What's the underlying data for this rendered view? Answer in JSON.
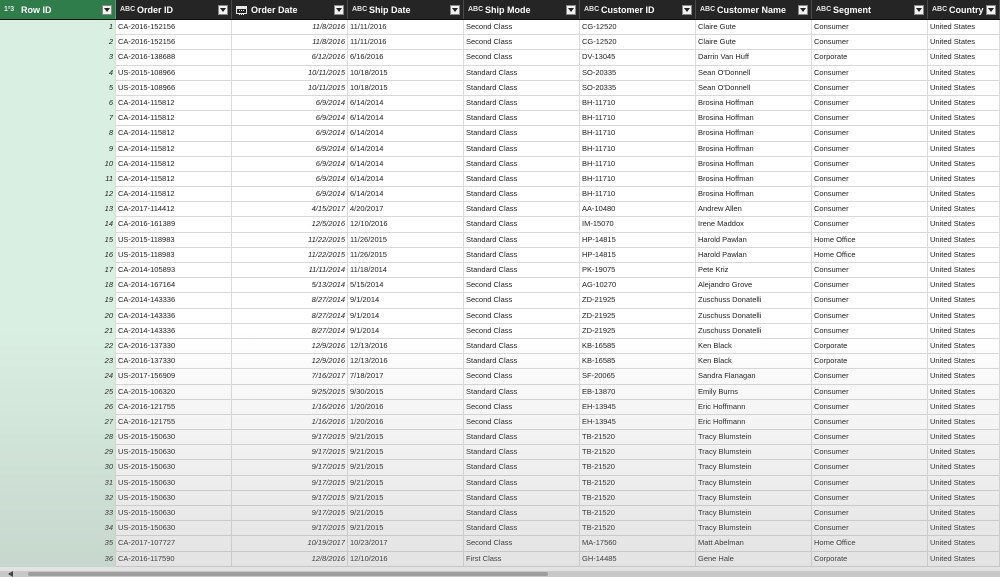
{
  "columns": [
    {
      "label": "Row ID",
      "type": "1²3"
    },
    {
      "label": "Order ID",
      "type": "ABC"
    },
    {
      "label": "Order Date",
      "type": "date"
    },
    {
      "label": "Ship Date",
      "type": "ABC"
    },
    {
      "label": "Ship Mode",
      "type": "ABC"
    },
    {
      "label": "Customer ID",
      "type": "ABC"
    },
    {
      "label": "Customer Name",
      "type": "ABC"
    },
    {
      "label": "Segment",
      "type": "ABC"
    },
    {
      "label": "Country",
      "type": "ABC"
    }
  ],
  "rows": [
    [
      "1",
      "CA-2016-152156",
      "11/8/2016",
      "11/11/2016",
      "Second Class",
      "CG-12520",
      "Claire Gute",
      "Consumer",
      "United States"
    ],
    [
      "2",
      "CA-2016-152156",
      "11/8/2016",
      "11/11/2016",
      "Second Class",
      "CG-12520",
      "Claire Gute",
      "Consumer",
      "United States"
    ],
    [
      "3",
      "CA-2016-138688",
      "6/12/2016",
      "6/16/2016",
      "Second Class",
      "DV-13045",
      "Darrin Van Huff",
      "Corporate",
      "United States"
    ],
    [
      "4",
      "US-2015-108966",
      "10/11/2015",
      "10/18/2015",
      "Standard Class",
      "SO-20335",
      "Sean O'Donnell",
      "Consumer",
      "United States"
    ],
    [
      "5",
      "US-2015-108966",
      "10/11/2015",
      "10/18/2015",
      "Standard Class",
      "SO-20335",
      "Sean O'Donnell",
      "Consumer",
      "United States"
    ],
    [
      "6",
      "CA-2014-115812",
      "6/9/2014",
      "6/14/2014",
      "Standard Class",
      "BH-11710",
      "Brosina Hoffman",
      "Consumer",
      "United States"
    ],
    [
      "7",
      "CA-2014-115812",
      "6/9/2014",
      "6/14/2014",
      "Standard Class",
      "BH-11710",
      "Brosina Hoffman",
      "Consumer",
      "United States"
    ],
    [
      "8",
      "CA-2014-115812",
      "6/9/2014",
      "6/14/2014",
      "Standard Class",
      "BH-11710",
      "Brosina Hoffman",
      "Consumer",
      "United States"
    ],
    [
      "9",
      "CA-2014-115812",
      "6/9/2014",
      "6/14/2014",
      "Standard Class",
      "BH-11710",
      "Brosina Hoffman",
      "Consumer",
      "United States"
    ],
    [
      "10",
      "CA-2014-115812",
      "6/9/2014",
      "6/14/2014",
      "Standard Class",
      "BH-11710",
      "Brosina Hoffman",
      "Consumer",
      "United States"
    ],
    [
      "11",
      "CA-2014-115812",
      "6/9/2014",
      "6/14/2014",
      "Standard Class",
      "BH-11710",
      "Brosina Hoffman",
      "Consumer",
      "United States"
    ],
    [
      "12",
      "CA-2014-115812",
      "6/9/2014",
      "6/14/2014",
      "Standard Class",
      "BH-11710",
      "Brosina Hoffman",
      "Consumer",
      "United States"
    ],
    [
      "13",
      "CA-2017-114412",
      "4/15/2017",
      "4/20/2017",
      "Standard Class",
      "AA-10480",
      "Andrew Allen",
      "Consumer",
      "United States"
    ],
    [
      "14",
      "CA-2016-161389",
      "12/5/2016",
      "12/10/2016",
      "Standard Class",
      "IM-15070",
      "Irene Maddox",
      "Consumer",
      "United States"
    ],
    [
      "15",
      "US-2015-118983",
      "11/22/2015",
      "11/26/2015",
      "Standard Class",
      "HP-14815",
      "Harold Pawlan",
      "Home Office",
      "United States"
    ],
    [
      "16",
      "US-2015-118983",
      "11/22/2015",
      "11/26/2015",
      "Standard Class",
      "HP-14815",
      "Harold Pawlan",
      "Home Office",
      "United States"
    ],
    [
      "17",
      "CA-2014-105893",
      "11/11/2014",
      "11/18/2014",
      "Standard Class",
      "PK-19075",
      "Pete Kriz",
      "Consumer",
      "United States"
    ],
    [
      "18",
      "CA-2014-167164",
      "5/13/2014",
      "5/15/2014",
      "Second Class",
      "AG-10270",
      "Alejandro Grove",
      "Consumer",
      "United States"
    ],
    [
      "19",
      "CA-2014-143336",
      "8/27/2014",
      "9/1/2014",
      "Second Class",
      "ZD-21925",
      "Zuschuss Donatelli",
      "Consumer",
      "United States"
    ],
    [
      "20",
      "CA-2014-143336",
      "8/27/2014",
      "9/1/2014",
      "Second Class",
      "ZD-21925",
      "Zuschuss Donatelli",
      "Consumer",
      "United States"
    ],
    [
      "21",
      "CA-2014-143336",
      "8/27/2014",
      "9/1/2014",
      "Second Class",
      "ZD-21925",
      "Zuschuss Donatelli",
      "Consumer",
      "United States"
    ],
    [
      "22",
      "CA-2016-137330",
      "12/9/2016",
      "12/13/2016",
      "Standard Class",
      "KB-16585",
      "Ken Black",
      "Corporate",
      "United States"
    ],
    [
      "23",
      "CA-2016-137330",
      "12/9/2016",
      "12/13/2016",
      "Standard Class",
      "KB-16585",
      "Ken Black",
      "Corporate",
      "United States"
    ],
    [
      "24",
      "US-2017-156909",
      "7/16/2017",
      "7/18/2017",
      "Second Class",
      "SF-20065",
      "Sandra Flanagan",
      "Consumer",
      "United States"
    ],
    [
      "25",
      "CA-2015-106320",
      "9/25/2015",
      "9/30/2015",
      "Standard Class",
      "EB-13870",
      "Emily Burns",
      "Consumer",
      "United States"
    ],
    [
      "26",
      "CA-2016-121755",
      "1/16/2016",
      "1/20/2016",
      "Second Class",
      "EH-13945",
      "Eric Hoffmann",
      "Consumer",
      "United States"
    ],
    [
      "27",
      "CA-2016-121755",
      "1/16/2016",
      "1/20/2016",
      "Second Class",
      "EH-13945",
      "Eric Hoffmann",
      "Consumer",
      "United States"
    ],
    [
      "28",
      "US-2015-150630",
      "9/17/2015",
      "9/21/2015",
      "Standard Class",
      "TB-21520",
      "Tracy Blumstein",
      "Consumer",
      "United States"
    ],
    [
      "29",
      "US-2015-150630",
      "9/17/2015",
      "9/21/2015",
      "Standard Class",
      "TB-21520",
      "Tracy Blumstein",
      "Consumer",
      "United States"
    ],
    [
      "30",
      "US-2015-150630",
      "9/17/2015",
      "9/21/2015",
      "Standard Class",
      "TB-21520",
      "Tracy Blumstein",
      "Consumer",
      "United States"
    ],
    [
      "31",
      "US-2015-150630",
      "9/17/2015",
      "9/21/2015",
      "Standard Class",
      "TB-21520",
      "Tracy Blumstein",
      "Consumer",
      "United States"
    ],
    [
      "32",
      "US-2015-150630",
      "9/17/2015",
      "9/21/2015",
      "Standard Class",
      "TB-21520",
      "Tracy Blumstein",
      "Consumer",
      "United States"
    ],
    [
      "33",
      "US-2015-150630",
      "9/17/2015",
      "9/21/2015",
      "Standard Class",
      "TB-21520",
      "Tracy Blumstein",
      "Consumer",
      "United States"
    ],
    [
      "34",
      "US-2015-150630",
      "9/17/2015",
      "9/21/2015",
      "Standard Class",
      "TB-21520",
      "Tracy Blumstein",
      "Consumer",
      "United States"
    ],
    [
      "35",
      "CA-2017-107727",
      "10/19/2017",
      "10/23/2017",
      "Second Class",
      "MA-17560",
      "Matt Abelman",
      "Home Office",
      "United States"
    ],
    [
      "36",
      "CA-2016-117590",
      "12/8/2016",
      "12/10/2016",
      "First Class",
      "GH-14485",
      "Gene Hale",
      "Corporate",
      "United States"
    ]
  ],
  "colors": {
    "header_bg": "#252525",
    "key_column_header": "#2f7d4a",
    "key_column_cells": "#d9efe1"
  }
}
